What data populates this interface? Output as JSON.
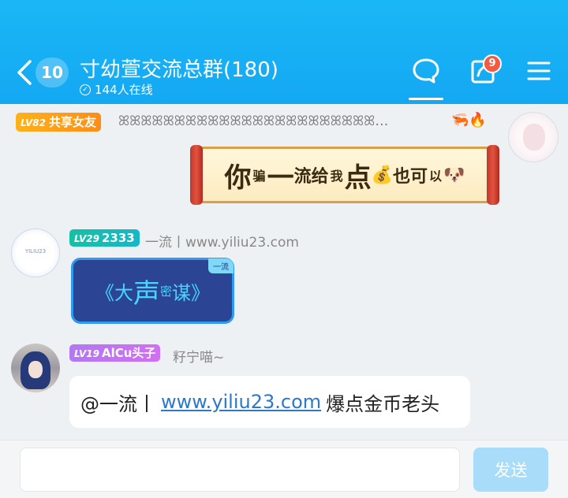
{
  "header": {
    "unread_count": "10",
    "title": "寸幼萱交流总群(180)",
    "online": "144人在线",
    "notification_count": "9"
  },
  "messages": [
    {
      "level": "LV82",
      "tag": "共享女友",
      "sender": "ꕤꕤꕤꕤꕤꕤꕤꕤꕤꕤꕤꕤꕤꕤꕤꕤꕤꕤꕤꕤꕤꕤꕤꕤ...",
      "decor": "🦐🔥",
      "bubble": {
        "p1": "你",
        "p2": "骗",
        "p3": "一",
        "p4": "流给",
        "p5": "我",
        "p6": "点",
        "p7": "💰",
        "p8": "也可",
        "p9": "以",
        "p10": "🐶"
      }
    },
    {
      "level": "LV29",
      "tag": "2333",
      "sender": "一流丨www.yiliu23.com",
      "avatar_text": "YILIU23",
      "card": {
        "corner": "一流",
        "p1": "《大",
        "p2": "声",
        "p3": "密",
        "p4": "谋》"
      }
    },
    {
      "level": "LV19",
      "tag": "AlCu头子",
      "sender": "籽宁喵~",
      "text_prefix": "@一流丨",
      "link": "www.yiliu23.com",
      "text_suffix": "爆点金币老头"
    }
  ],
  "composer": {
    "placeholder": "",
    "send_label": "发送"
  }
}
